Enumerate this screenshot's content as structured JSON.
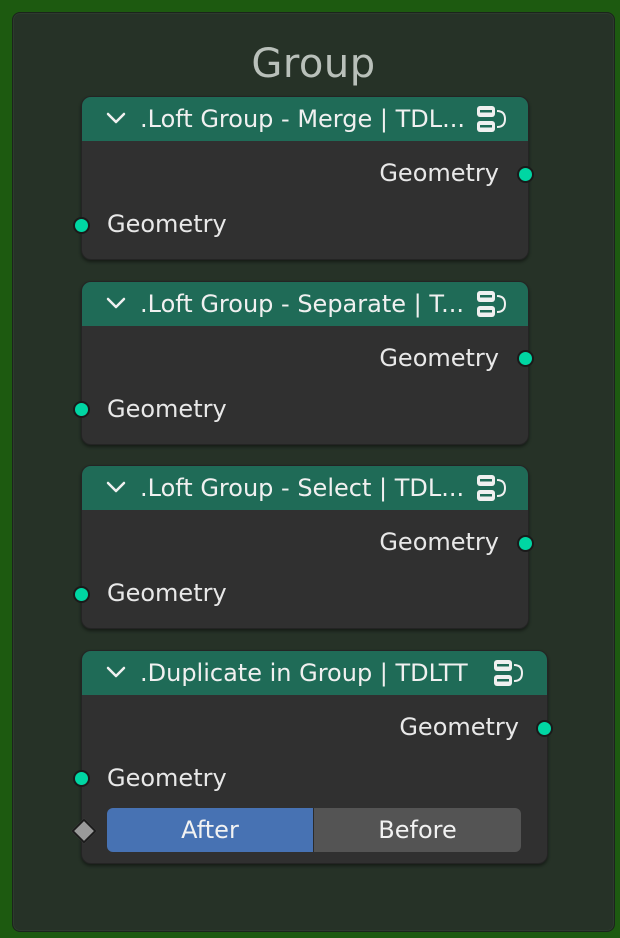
{
  "frame": {
    "title": "Group"
  },
  "nodes": [
    {
      "title": ".Loft Group - Merge | TDL...",
      "output": "Geometry",
      "input": "Geometry"
    },
    {
      "title": ".Loft Group - Separate | T...",
      "output": "Geometry",
      "input": "Geometry"
    },
    {
      "title": ".Loft Group - Select | TDL...",
      "output": "Geometry",
      "input": "Geometry"
    },
    {
      "title": ".Duplicate in Group | TDLTT",
      "output": "Geometry",
      "input": "Geometry",
      "mode": {
        "options": [
          "After",
          "Before"
        ],
        "selected": "After"
      }
    }
  ],
  "colors": {
    "header": "#1f6b57",
    "socket_geometry": "#00d6a3",
    "selected": "#4772b3",
    "frame_bg": "#263227",
    "canvas": "#1d5a10"
  },
  "icons": {
    "collapse": "chevron-down-icon",
    "node_group": "node-group-icon",
    "value_socket": "diamond-socket-icon"
  }
}
